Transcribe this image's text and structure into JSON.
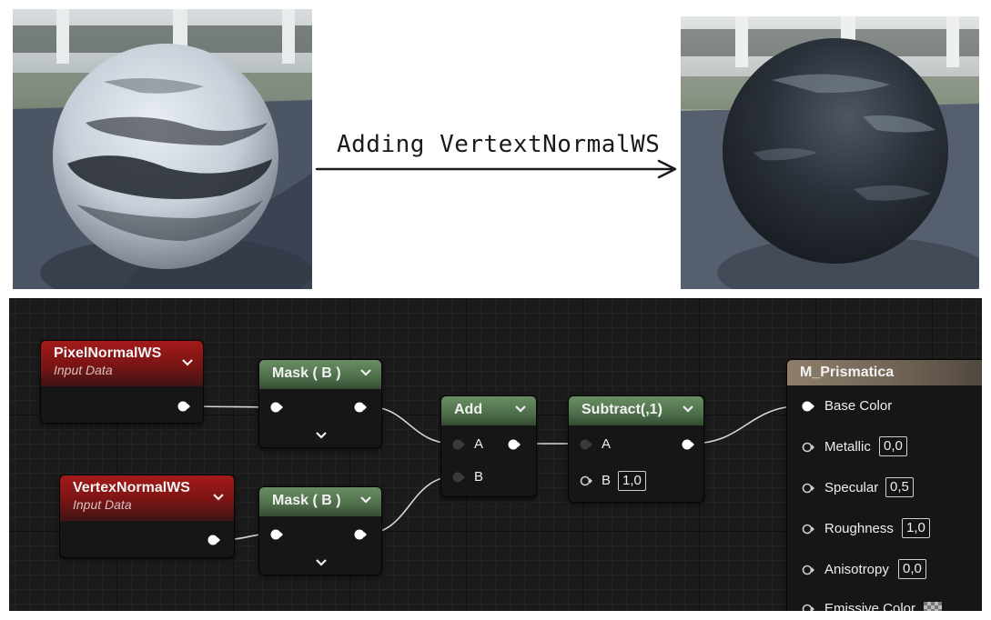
{
  "annotation": {
    "label": "Adding VertextNormalWS"
  },
  "renders": {
    "before_icon": "rough-stone-sphere-light",
    "after_icon": "rough-stone-sphere-dark"
  },
  "nodes": {
    "pixel_normal": {
      "title": "PixelNormalWS",
      "subtitle": "Input Data",
      "color": "#8a1616"
    },
    "vertex_normal": {
      "title": "VertexNormalWS",
      "subtitle": "Input Data",
      "color": "#8a1616"
    },
    "mask_top": {
      "title": "Mask ( B )",
      "color": "#5a7c55"
    },
    "mask_bottom": {
      "title": "Mask ( B )",
      "color": "#5a7c55"
    },
    "add": {
      "title": "Add",
      "pin_a": "A",
      "pin_b": "B",
      "color": "#5a7c55"
    },
    "subtract": {
      "title": "Subtract(,1)",
      "pin_a": "A",
      "pin_b": "B",
      "b_value": "1,0",
      "color": "#5a7c55"
    },
    "material": {
      "title": "M_Prismatica",
      "color": "#7d705f",
      "inputs": [
        {
          "label": "Base Color",
          "value": ""
        },
        {
          "label": "Metallic",
          "value": "0,0"
        },
        {
          "label": "Specular",
          "value": "0,5"
        },
        {
          "label": "Roughness",
          "value": "1,0"
        },
        {
          "label": "Anisotropy",
          "value": "0,0"
        },
        {
          "label": "Emissive Color",
          "value": ""
        }
      ]
    }
  },
  "icons": {
    "collapse": "chevron-down-icon",
    "pin_connected": "exec-pin-filled",
    "pin_empty": "exec-pin-empty"
  }
}
